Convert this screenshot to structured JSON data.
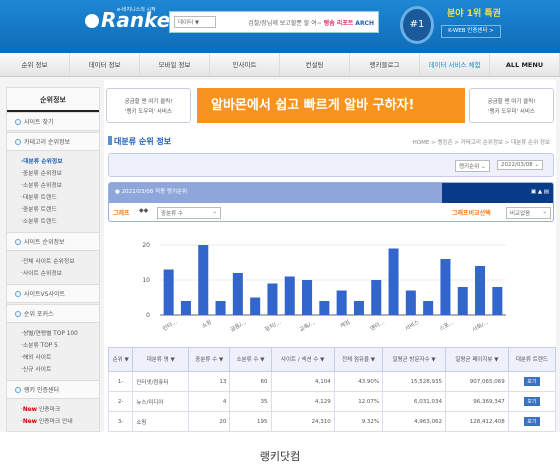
{
  "header": {
    "logo": "Rankey",
    "tagline": "e-비지니스의 시작",
    "search_category": "데이터",
    "search_hint": "검찰/장님께 보고할뿐 할 여~",
    "search_hint_hl": "랭솜 리포트",
    "search_btn": "ARCH",
    "badge": "#1",
    "promo": "분야 1위 특권",
    "kweb": "K-WEB 인증센터 >"
  },
  "nav": [
    "순위 정보",
    "데이터 정보",
    "모바일 정보",
    "인사이트",
    "컨설팅",
    "랭키블로그",
    "데이터 서비스 체험",
    "ALL MENU"
  ],
  "sidebar": {
    "title": "순위정보",
    "groups": [
      {
        "label": "사이트 찾기",
        "items": []
      },
      {
        "label": "카테고리 순위정보",
        "items": [
          "대분류 순위정보",
          "중분류 순위정보",
          "소분류 순위정보",
          "대분류 트렌드",
          "중분류 트렌드",
          "소분류 트렌드"
        ]
      },
      {
        "label": "사이트 순위정보",
        "items": [
          "전체 사이트 순위정보",
          "사이트 순위정보"
        ]
      },
      {
        "label": "사이트VS사이트",
        "items": []
      },
      {
        "label": "순위 포커스",
        "items": [
          "성별/연령별 TOP 100",
          "소분류 TOP 5",
          "해외 사이트",
          "신규 사이트"
        ]
      },
      {
        "label": "랭키 인증센터",
        "items": [
          "인증마크",
          "인증마크 안내"
        ]
      }
    ],
    "new_label": "New"
  },
  "banners": {
    "help": "궁금할 땐 여기 클릭!",
    "help2": "'랭키 도우미' 서비스",
    "ad": "알바몬에서 쉽고 빠르게 알바 구하자!"
  },
  "page": {
    "title": "대분류 순위 정보",
    "breadcrumb": "HOME > 랭킹존 > 카테고리 순위정보 > 대분류 순위 정보",
    "rank_select": "랭키순위",
    "date_select": "2022/03/08",
    "box_title": "2022/03/08 적용 랭키순위",
    "graph_label": "그래프",
    "graph_select": "중분류 수",
    "compare_label": "그래프비교선택",
    "compare_select": "비교없음"
  },
  "chart_data": {
    "type": "bar",
    "ylim": [
      0,
      20
    ],
    "yticks": [
      "0",
      "10",
      "20"
    ],
    "values": [
      13,
      4,
      20,
      4,
      12,
      5,
      9,
      11,
      10,
      4,
      7,
      4,
      10,
      19,
      7,
      4,
      16,
      8,
      14,
      8
    ],
    "xlabels": [
      "인터...",
      "쇼핑",
      "금융/...",
      "정치/...",
      "교육/...",
      "게임",
      "엔터...",
      "서비스",
      "스포...",
      "사회/..."
    ],
    "color": "#3366cc"
  },
  "table": {
    "headers": [
      "순위 ▼",
      "대분류 명 ▼",
      "중분류 수 ▼",
      "소분류 수 ▼",
      "사이트 / 섹션 수 ▼",
      "전체 점유율 ▼",
      "일평균 방문자수 ▼",
      "일평균 페이지뷰 ▼",
      "대분류 트렌드"
    ],
    "rows": [
      [
        "1-",
        "인터넷/컴퓨터",
        "13",
        "60",
        "4,104",
        "43.90%",
        "15,528,935",
        "907,065,069",
        "보기"
      ],
      [
        "2-",
        "뉴스/미디어",
        "4",
        "35",
        "4,129",
        "12.07%",
        "6,031,034",
        "96,369,347",
        "보기"
      ],
      [
        "3-",
        "쇼핑",
        "20",
        "195",
        "24,310",
        "9.32%",
        "4,963,062",
        "128,412,408",
        "보기"
      ]
    ]
  },
  "caption": "랭키닷컴"
}
